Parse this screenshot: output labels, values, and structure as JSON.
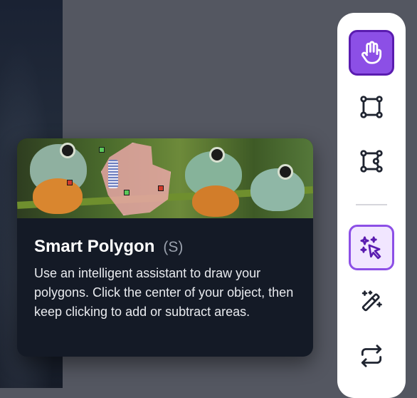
{
  "tooltip": {
    "title": "Smart Polygon",
    "shortcut": "(S)",
    "description": "Use an intelligent assistant to draw your polygons. Click the center of your object, then keep clicking to add or subtract areas."
  },
  "toolbar": {
    "tools": [
      {
        "name": "Pan",
        "icon": "hand-icon",
        "state": "active"
      },
      {
        "name": "Bounding Box",
        "icon": "bounding-box-icon",
        "state": "default"
      },
      {
        "name": "Polygon",
        "icon": "polygon-icon",
        "state": "default"
      },
      {
        "name": "Smart Polygon",
        "icon": "smart-polygon-icon",
        "state": "selected"
      },
      {
        "name": "Magic Wand",
        "icon": "magic-wand-icon",
        "state": "default"
      },
      {
        "name": "Repeat",
        "icon": "repeat-icon",
        "state": "default"
      }
    ]
  },
  "colors": {
    "accent": "#8c4fe6",
    "accent_dark": "#5a1cb0",
    "selected_bg": "#f1e6ff",
    "tooltip_bg": "#141a26",
    "workspace_bg": "#545761"
  }
}
